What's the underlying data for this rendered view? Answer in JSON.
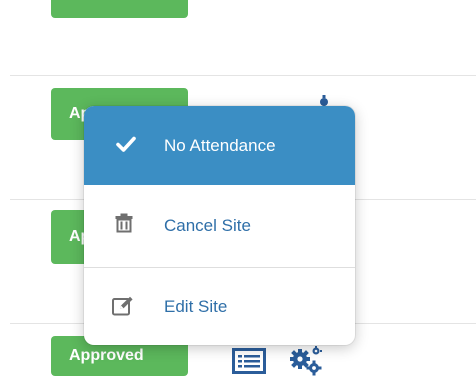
{
  "rows": [
    {
      "status": ""
    },
    {
      "status": "Approved"
    },
    {
      "status": "Approved"
    },
    {
      "status": "Approved"
    }
  ],
  "context_menu": {
    "items": [
      {
        "label": "No Attendance",
        "icon": "check-icon",
        "active": true
      },
      {
        "label": "Cancel Site",
        "icon": "trash-icon",
        "active": false
      },
      {
        "label": "Edit Site",
        "icon": "edit-icon",
        "active": false
      }
    ]
  },
  "row_actions": {
    "list_icon": "list-icon",
    "settings_icon": "gears-icon"
  },
  "colors": {
    "approved_badge": "#5cb85c",
    "menu_active_bg": "#3b8ec4",
    "menu_link": "#2f6fa8",
    "icon_blue": "#2b5d9a",
    "divider": "#e4e4e4"
  }
}
